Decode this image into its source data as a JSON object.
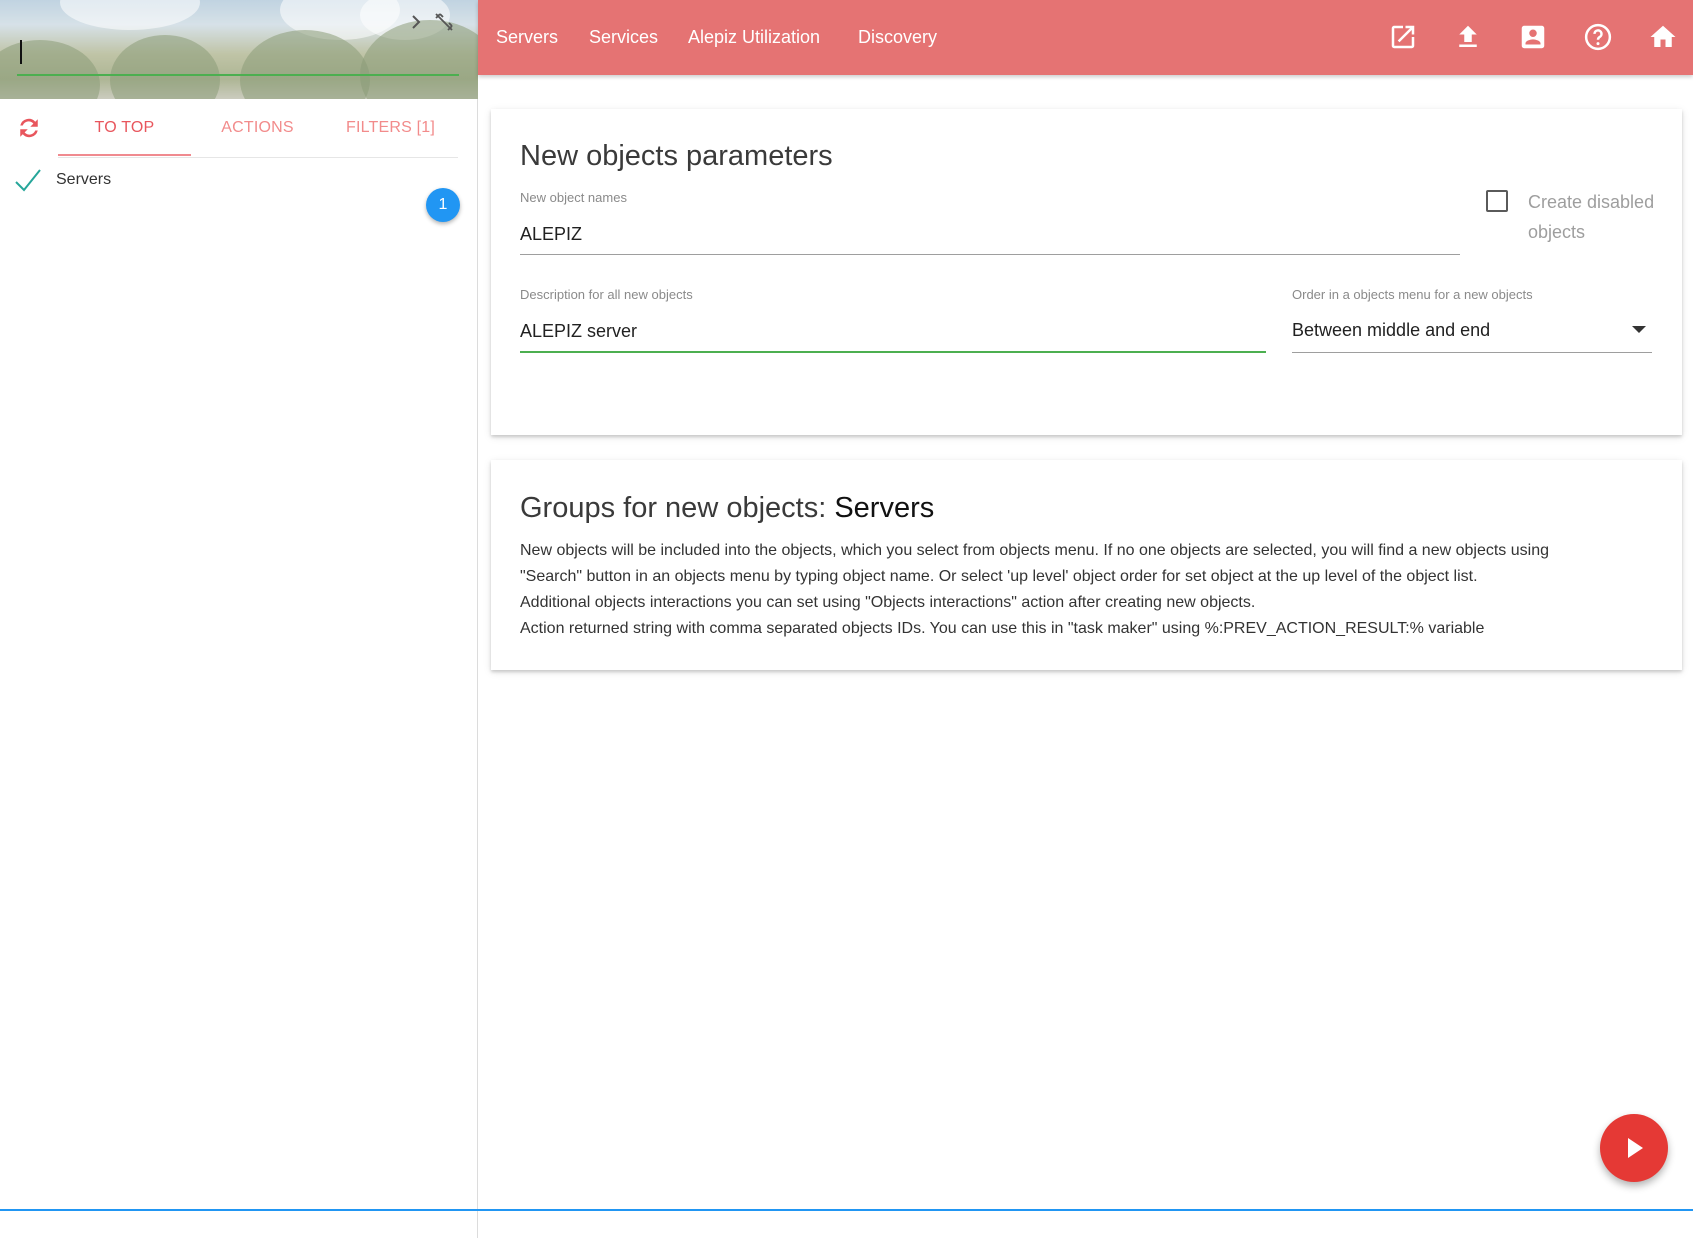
{
  "sidebar": {
    "search": {
      "value": "",
      "placeholder": ""
    },
    "tabs": [
      {
        "label": "TO TOP"
      },
      {
        "label": "ACTIONS"
      },
      {
        "label": "FILTERS [1]"
      }
    ],
    "active_tab": "TO TOP",
    "objects": [
      {
        "label": "Servers",
        "checked": true
      }
    ],
    "selected_count": "1"
  },
  "topnav": {
    "links": [
      {
        "label": "Servers"
      },
      {
        "label": "Services"
      },
      {
        "label": "Alepiz Utilization"
      },
      {
        "label": "Discovery"
      }
    ],
    "icons": [
      "open-in-new-icon",
      "upload-icon",
      "account-box-icon",
      "help-icon",
      "home-icon"
    ],
    "color": "#e57373"
  },
  "params_card": {
    "title": "New objects parameters",
    "names_label": "New object names",
    "names_value": "ALEPIZ",
    "create_disabled_label": "Create disabled objects",
    "create_disabled_checked": false,
    "description_label": "Description for all new objects",
    "description_value": "ALEPIZ server",
    "order_label": "Order in a objects menu for a new objects",
    "order_value": "Between middle and end"
  },
  "groups_card": {
    "title_prefix": "Groups for new objects: ",
    "title_value": "Servers",
    "lines": [
      "New objects will be included into the objects, which you select from objects menu. If no one objects are selected, you will find a new objects using",
      "\"Search\" button in an objects menu by typing object name. Or select 'up level' object order for set object at the up level of the object list.",
      "Additional objects interactions you can set using \"Objects interactions\" action after creating new objects.",
      "Action returned string with comma separated objects IDs. You can use this in \"task maker\" using %:PREV_ACTION_RESULT:% variable"
    ]
  },
  "run_button": {
    "icon": "play-icon",
    "color": "#e53935"
  },
  "colors": {
    "accent": "#e57373",
    "focus": "#4caf50",
    "badge": "#2196f3"
  }
}
